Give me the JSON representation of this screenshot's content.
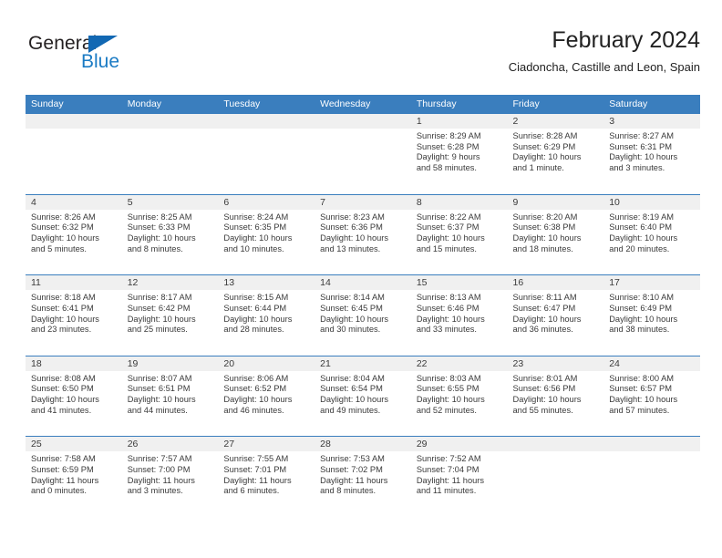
{
  "brand": {
    "name_part1": "General",
    "name_part2": "Blue",
    "triangle_icon": "blue-triangle-logo-mark",
    "accent_color": "#1268b3",
    "secondary_color": "#1b7bc4"
  },
  "header": {
    "title": "February 2024",
    "subtitle": "Ciadoncha, Castille and Leon, Spain"
  },
  "theme": {
    "header_bar_color": "#3a7ebe",
    "day_band_color": "#f0f0f0",
    "text_color": "#3a3a3a"
  },
  "weekdays": [
    {
      "label": "Sunday"
    },
    {
      "label": "Monday"
    },
    {
      "label": "Tuesday"
    },
    {
      "label": "Wednesday"
    },
    {
      "label": "Thursday"
    },
    {
      "label": "Friday"
    },
    {
      "label": "Saturday"
    }
  ],
  "weeks": [
    {
      "days": [
        {
          "number": "",
          "empty": true,
          "sunrise": "",
          "sunset": "",
          "daylight_line1": "",
          "daylight_line2": ""
        },
        {
          "number": "",
          "empty": true,
          "sunrise": "",
          "sunset": "",
          "daylight_line1": "",
          "daylight_line2": ""
        },
        {
          "number": "",
          "empty": true,
          "sunrise": "",
          "sunset": "",
          "daylight_line1": "",
          "daylight_line2": ""
        },
        {
          "number": "",
          "empty": true,
          "sunrise": "",
          "sunset": "",
          "daylight_line1": "",
          "daylight_line2": ""
        },
        {
          "number": "1",
          "empty": false,
          "sunrise": "Sunrise: 8:29 AM",
          "sunset": "Sunset: 6:28 PM",
          "daylight_line1": "Daylight: 9 hours",
          "daylight_line2": "and 58 minutes."
        },
        {
          "number": "2",
          "empty": false,
          "sunrise": "Sunrise: 8:28 AM",
          "sunset": "Sunset: 6:29 PM",
          "daylight_line1": "Daylight: 10 hours",
          "daylight_line2": "and 1 minute."
        },
        {
          "number": "3",
          "empty": false,
          "sunrise": "Sunrise: 8:27 AM",
          "sunset": "Sunset: 6:31 PM",
          "daylight_line1": "Daylight: 10 hours",
          "daylight_line2": "and 3 minutes."
        }
      ]
    },
    {
      "days": [
        {
          "number": "4",
          "empty": false,
          "sunrise": "Sunrise: 8:26 AM",
          "sunset": "Sunset: 6:32 PM",
          "daylight_line1": "Daylight: 10 hours",
          "daylight_line2": "and 5 minutes."
        },
        {
          "number": "5",
          "empty": false,
          "sunrise": "Sunrise: 8:25 AM",
          "sunset": "Sunset: 6:33 PM",
          "daylight_line1": "Daylight: 10 hours",
          "daylight_line2": "and 8 minutes."
        },
        {
          "number": "6",
          "empty": false,
          "sunrise": "Sunrise: 8:24 AM",
          "sunset": "Sunset: 6:35 PM",
          "daylight_line1": "Daylight: 10 hours",
          "daylight_line2": "and 10 minutes."
        },
        {
          "number": "7",
          "empty": false,
          "sunrise": "Sunrise: 8:23 AM",
          "sunset": "Sunset: 6:36 PM",
          "daylight_line1": "Daylight: 10 hours",
          "daylight_line2": "and 13 minutes."
        },
        {
          "number": "8",
          "empty": false,
          "sunrise": "Sunrise: 8:22 AM",
          "sunset": "Sunset: 6:37 PM",
          "daylight_line1": "Daylight: 10 hours",
          "daylight_line2": "and 15 minutes."
        },
        {
          "number": "9",
          "empty": false,
          "sunrise": "Sunrise: 8:20 AM",
          "sunset": "Sunset: 6:38 PM",
          "daylight_line1": "Daylight: 10 hours",
          "daylight_line2": "and 18 minutes."
        },
        {
          "number": "10",
          "empty": false,
          "sunrise": "Sunrise: 8:19 AM",
          "sunset": "Sunset: 6:40 PM",
          "daylight_line1": "Daylight: 10 hours",
          "daylight_line2": "and 20 minutes."
        }
      ]
    },
    {
      "days": [
        {
          "number": "11",
          "empty": false,
          "sunrise": "Sunrise: 8:18 AM",
          "sunset": "Sunset: 6:41 PM",
          "daylight_line1": "Daylight: 10 hours",
          "daylight_line2": "and 23 minutes."
        },
        {
          "number": "12",
          "empty": false,
          "sunrise": "Sunrise: 8:17 AM",
          "sunset": "Sunset: 6:42 PM",
          "daylight_line1": "Daylight: 10 hours",
          "daylight_line2": "and 25 minutes."
        },
        {
          "number": "13",
          "empty": false,
          "sunrise": "Sunrise: 8:15 AM",
          "sunset": "Sunset: 6:44 PM",
          "daylight_line1": "Daylight: 10 hours",
          "daylight_line2": "and 28 minutes."
        },
        {
          "number": "14",
          "empty": false,
          "sunrise": "Sunrise: 8:14 AM",
          "sunset": "Sunset: 6:45 PM",
          "daylight_line1": "Daylight: 10 hours",
          "daylight_line2": "and 30 minutes."
        },
        {
          "number": "15",
          "empty": false,
          "sunrise": "Sunrise: 8:13 AM",
          "sunset": "Sunset: 6:46 PM",
          "daylight_line1": "Daylight: 10 hours",
          "daylight_line2": "and 33 minutes."
        },
        {
          "number": "16",
          "empty": false,
          "sunrise": "Sunrise: 8:11 AM",
          "sunset": "Sunset: 6:47 PM",
          "daylight_line1": "Daylight: 10 hours",
          "daylight_line2": "and 36 minutes."
        },
        {
          "number": "17",
          "empty": false,
          "sunrise": "Sunrise: 8:10 AM",
          "sunset": "Sunset: 6:49 PM",
          "daylight_line1": "Daylight: 10 hours",
          "daylight_line2": "and 38 minutes."
        }
      ]
    },
    {
      "days": [
        {
          "number": "18",
          "empty": false,
          "sunrise": "Sunrise: 8:08 AM",
          "sunset": "Sunset: 6:50 PM",
          "daylight_line1": "Daylight: 10 hours",
          "daylight_line2": "and 41 minutes."
        },
        {
          "number": "19",
          "empty": false,
          "sunrise": "Sunrise: 8:07 AM",
          "sunset": "Sunset: 6:51 PM",
          "daylight_line1": "Daylight: 10 hours",
          "daylight_line2": "and 44 minutes."
        },
        {
          "number": "20",
          "empty": false,
          "sunrise": "Sunrise: 8:06 AM",
          "sunset": "Sunset: 6:52 PM",
          "daylight_line1": "Daylight: 10 hours",
          "daylight_line2": "and 46 minutes."
        },
        {
          "number": "21",
          "empty": false,
          "sunrise": "Sunrise: 8:04 AM",
          "sunset": "Sunset: 6:54 PM",
          "daylight_line1": "Daylight: 10 hours",
          "daylight_line2": "and 49 minutes."
        },
        {
          "number": "22",
          "empty": false,
          "sunrise": "Sunrise: 8:03 AM",
          "sunset": "Sunset: 6:55 PM",
          "daylight_line1": "Daylight: 10 hours",
          "daylight_line2": "and 52 minutes."
        },
        {
          "number": "23",
          "empty": false,
          "sunrise": "Sunrise: 8:01 AM",
          "sunset": "Sunset: 6:56 PM",
          "daylight_line1": "Daylight: 10 hours",
          "daylight_line2": "and 55 minutes."
        },
        {
          "number": "24",
          "empty": false,
          "sunrise": "Sunrise: 8:00 AM",
          "sunset": "Sunset: 6:57 PM",
          "daylight_line1": "Daylight: 10 hours",
          "daylight_line2": "and 57 minutes."
        }
      ]
    },
    {
      "days": [
        {
          "number": "25",
          "empty": false,
          "sunrise": "Sunrise: 7:58 AM",
          "sunset": "Sunset: 6:59 PM",
          "daylight_line1": "Daylight: 11 hours",
          "daylight_line2": "and 0 minutes."
        },
        {
          "number": "26",
          "empty": false,
          "sunrise": "Sunrise: 7:57 AM",
          "sunset": "Sunset: 7:00 PM",
          "daylight_line1": "Daylight: 11 hours",
          "daylight_line2": "and 3 minutes."
        },
        {
          "number": "27",
          "empty": false,
          "sunrise": "Sunrise: 7:55 AM",
          "sunset": "Sunset: 7:01 PM",
          "daylight_line1": "Daylight: 11 hours",
          "daylight_line2": "and 6 minutes."
        },
        {
          "number": "28",
          "empty": false,
          "sunrise": "Sunrise: 7:53 AM",
          "sunset": "Sunset: 7:02 PM",
          "daylight_line1": "Daylight: 11 hours",
          "daylight_line2": "and 8 minutes."
        },
        {
          "number": "29",
          "empty": false,
          "sunrise": "Sunrise: 7:52 AM",
          "sunset": "Sunset: 7:04 PM",
          "daylight_line1": "Daylight: 11 hours",
          "daylight_line2": "and 11 minutes."
        },
        {
          "number": "",
          "empty": true,
          "sunrise": "",
          "sunset": "",
          "daylight_line1": "",
          "daylight_line2": ""
        },
        {
          "number": "",
          "empty": true,
          "sunrise": "",
          "sunset": "",
          "daylight_line1": "",
          "daylight_line2": ""
        }
      ]
    }
  ]
}
